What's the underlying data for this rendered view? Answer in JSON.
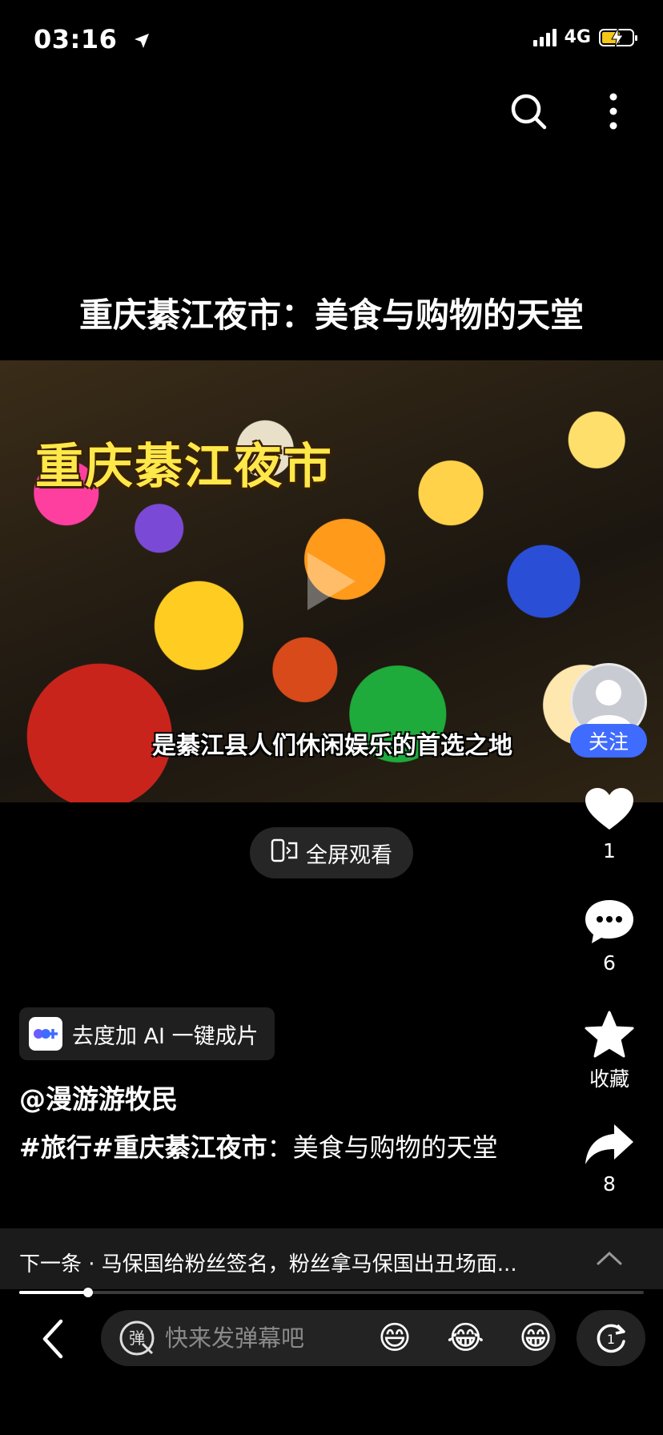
{
  "status_bar": {
    "time": "03:16",
    "network": "4G"
  },
  "video": {
    "title": "重庆綦江夜市：美食与购物的天堂",
    "overlay_title": "重庆綦江夜市",
    "subtitle": "是綦江县人们休闲娱乐的首选之地",
    "fullscreen_label": "全屏观看"
  },
  "author": {
    "follow_label": "关注",
    "handle": "@漫游游牧民"
  },
  "actions": {
    "like_count": "1",
    "comment_count": "6",
    "favorite_label": "收藏",
    "share_count": "8"
  },
  "ai_chip": {
    "label": "去度加 AI 一键成片"
  },
  "description": {
    "tag1": "#旅行",
    "tag2": "#重庆綦江夜市",
    "text": "：美食与购物的天堂"
  },
  "next_up": {
    "text": "下一条 · 马保国给粉丝签名，粉丝拿马保国出丑场面..."
  },
  "playback": {
    "progress": 0.11
  },
  "danmu": {
    "placeholder": "快来发弹幕吧",
    "emojis": [
      "😄",
      "😂",
      "😁"
    ]
  },
  "colors": {
    "accent": "#3f6bff",
    "background": "#000000",
    "battery": "#f5c518"
  }
}
